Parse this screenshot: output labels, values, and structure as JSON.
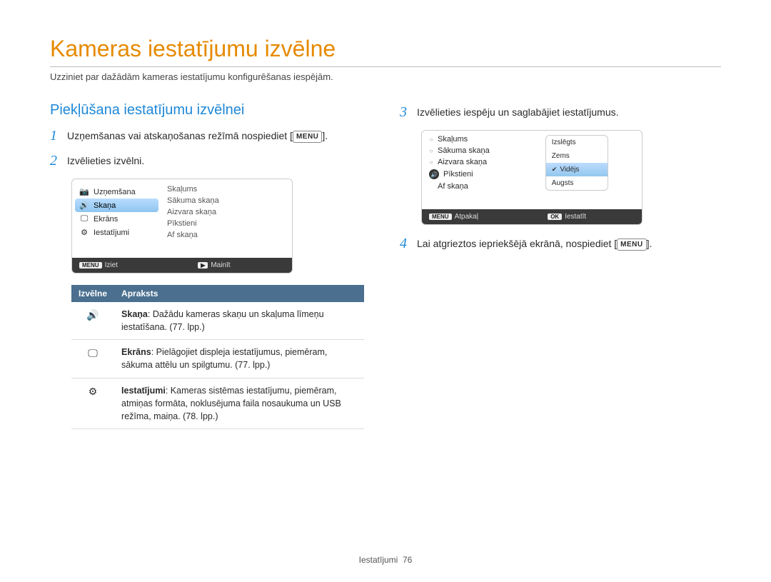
{
  "title": "Kameras iestatījumu izvēlne",
  "subtitle": "Uzziniet par dažādām kameras iestatījumu konfigurēšanas iespējām.",
  "section_heading": "Piekļūšana iestatījumu izvēlnei",
  "menu_button": "MENU",
  "steps": {
    "s1": "Uzņemšanas vai atskaņošanas režīmā nospiediet [",
    "s1_after": "].",
    "s2": "Izvēlieties izvēlni.",
    "s3": "Izvēlieties iespēju un saglabājiet iestatījumus.",
    "s4": "Lai atgrieztos iepriekšējā ekrānā, nospiediet [",
    "s4_after": "]."
  },
  "panel1": {
    "left": [
      {
        "icon": "camera",
        "label": "Uzņemšana"
      },
      {
        "icon": "sound",
        "label": "Skaņa",
        "selected": true
      },
      {
        "icon": "display",
        "label": "Ekrāns"
      },
      {
        "icon": "gear",
        "label": "Iestatījumi"
      }
    ],
    "right": [
      "Skaļums",
      "Sākuma skaņa",
      "Aizvara skaņa",
      "Pīkstieni",
      "Af skaņa"
    ],
    "footer_left_btn": "MENU",
    "footer_left_label": "Iziet",
    "footer_right_btn": "▶",
    "footer_right_label": "Mainīt"
  },
  "panel2": {
    "left": [
      {
        "dot": true,
        "label": "Skaļums"
      },
      {
        "dot": true,
        "label": "Sākuma skaņa"
      },
      {
        "dot": true,
        "label": "Aizvara skaņa"
      },
      {
        "icon": "sound",
        "label": "Pīkstieni"
      },
      {
        "empty": true,
        "label": "Af skaņa"
      }
    ],
    "values": [
      "Izslēgts",
      "Zems",
      "Vidējs",
      "Augsts"
    ],
    "selected_value": "Vidējs",
    "footer_left_btn": "MENU",
    "footer_left_label": "Atpakaļ",
    "footer_right_btn": "OK",
    "footer_right_label": "Iestatīt"
  },
  "table": {
    "head_menu": "Izvēlne",
    "head_desc": "Apraksts",
    "rows": [
      {
        "icon": "sound",
        "title": "Skaņa",
        "text": ": Dažādu kameras skaņu un skaļuma līmeņu iestatīšana. (77. lpp.)"
      },
      {
        "icon": "display",
        "title": "Ekrāns",
        "text": ": Pielāgojiet displeja iestatījumus, piemēram, sākuma attēlu un spilgtumu. (77. lpp.)"
      },
      {
        "icon": "gear",
        "title": "Iestatījumi",
        "text": ": Kameras sistēmas iestatījumu, piemēram, atmiņas formāta, noklusējuma faila nosaukuma un USB režīma, maiņa. (78. lpp.)"
      }
    ]
  },
  "footer": {
    "section": "Iestatījumi",
    "page": "76"
  }
}
